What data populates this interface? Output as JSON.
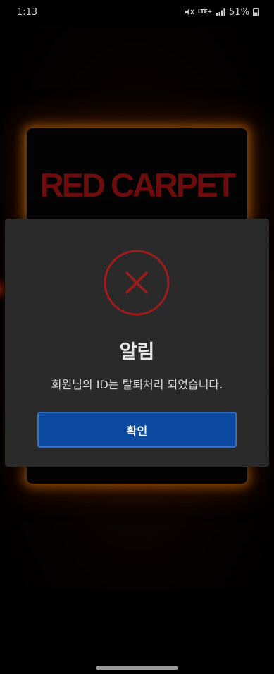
{
  "status_bar": {
    "time": "1:13",
    "network": "LTE+",
    "battery": "51%",
    "icons": [
      "mute-vibrate-icon",
      "lte-plus-icon",
      "signal-icon",
      "battery-icon"
    ]
  },
  "app": {
    "title": "RED CARPET",
    "title_color": "#6d0c0c",
    "glow_color": "#d67812"
  },
  "dialog": {
    "icon": "error-x-icon",
    "icon_color": "#a01c1c",
    "title": "알림",
    "message": "회원님의 ID는 탈퇴처리 되었습니다.",
    "confirm_label": "확인",
    "confirm_color": "#0b4aa0"
  }
}
